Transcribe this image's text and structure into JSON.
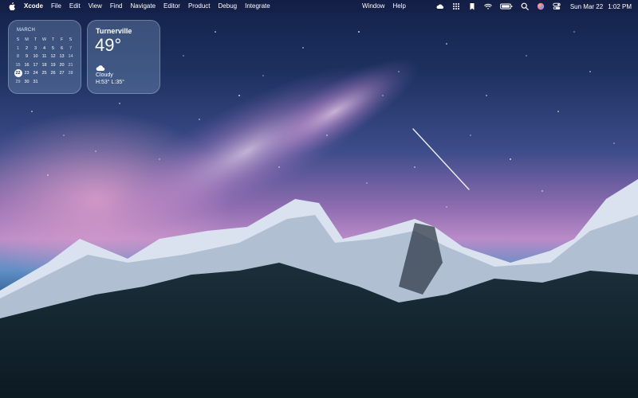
{
  "menubar": {
    "app_name": "Xcode",
    "menus": [
      "File",
      "Edit",
      "View",
      "Find",
      "Navigate",
      "Editor",
      "Product",
      "Debug",
      "Integrate"
    ],
    "menus_right": [
      "Window",
      "Help"
    ],
    "status_icons": [
      "cloud-icon",
      "grid-icon",
      "bookmark-icon",
      "wifi-icon",
      "battery-icon",
      "search-icon",
      "siri-icon",
      "control-center-icon"
    ],
    "date": "Sun Mar 22",
    "time": "1:02 PM"
  },
  "calendar_widget": {
    "month": "MARCH",
    "weekdays": [
      "S",
      "M",
      "T",
      "W",
      "T",
      "F",
      "S"
    ],
    "weeks": [
      [
        "1",
        "2",
        "3",
        "4",
        "5",
        "6",
        "7"
      ],
      [
        "8",
        "9",
        "10",
        "11",
        "12",
        "13",
        "14"
      ],
      [
        "15",
        "16",
        "17",
        "18",
        "19",
        "20",
        "21"
      ],
      [
        "22",
        "23",
        "24",
        "25",
        "26",
        "27",
        "28"
      ],
      [
        "29",
        "30",
        "31",
        "",
        "",
        "",
        ""
      ]
    ],
    "today": "22"
  },
  "weather_widget": {
    "city": "Turnerville",
    "temperature": "49°",
    "condition": "Cloudy",
    "high_low": "H:53° L:35°",
    "icon": "cloud-icon"
  }
}
